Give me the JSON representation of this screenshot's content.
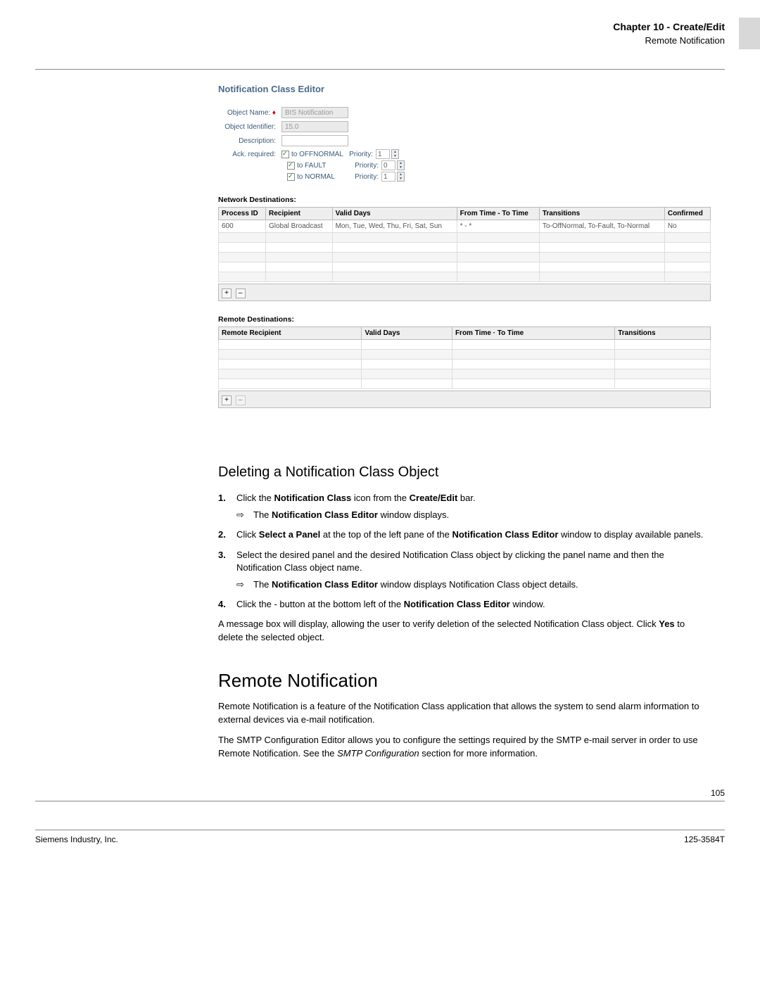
{
  "header": {
    "chapter": "Chapter 10 - Create/Edit",
    "section": "Remote Notification"
  },
  "editor": {
    "title": "Notification Class Editor",
    "labels": {
      "object_name": "Object Name:",
      "object_identifier": "Object Identifier:",
      "description": "Description:",
      "ack_required": "Ack. required:",
      "priority": "Priority:"
    },
    "values": {
      "object_name": "BIS Notification",
      "object_identifier": "15.0",
      "description": ""
    },
    "ack": {
      "offnormal": {
        "label": "to OFFNORMAL",
        "priority": "1"
      },
      "fault": {
        "label": "to FAULT",
        "priority": "0"
      },
      "normal": {
        "label": "to NORMAL",
        "priority": "1"
      }
    },
    "network": {
      "heading": "Network Destinations:",
      "cols": {
        "process_id": "Process ID",
        "recipient": "Recipient",
        "valid_days": "Valid Days",
        "from_to": "From Time - To Time",
        "transitions": "Transitions",
        "confirmed": "Confirmed"
      },
      "row1": {
        "process_id": "600",
        "recipient": "Global Broadcast",
        "valid_days": "Mon, Tue, Wed, Thu, Fri, Sat, Sun",
        "from_to": "*  -  *",
        "transitions": "To-OffNormal, To-Fault, To-Normal",
        "confirmed": "No"
      }
    },
    "remote": {
      "heading": "Remote Destinations:",
      "cols": {
        "remote_recipient": "Remote Recipient",
        "valid_days": "Valid Days",
        "from_to": "From Time · To Time",
        "transitions": "Transitions"
      }
    },
    "buttons": {
      "plus": "+",
      "minus": "–"
    }
  },
  "doc": {
    "deleting_h": "Deleting a Notification Class Object",
    "step1_pre": "Click the ",
    "step1_b1": "Notification Class",
    "step1_mid": " icon from the ",
    "step1_b2": "Create/Edit",
    "step1_post": " bar.",
    "step1_sub_pre": "The ",
    "step1_sub_b": "Notification Class Editor",
    "step1_sub_post": " window displays.",
    "step2_pre": "Click ",
    "step2_b1": "Select a Panel",
    "step2_mid": " at the top of the left pane of the ",
    "step2_b2": "Notification Class Editor",
    "step2_post": " window to display available panels.",
    "step3": "Select the desired panel and the desired Notification Class object by clicking the panel name and then the Notification Class object name.",
    "step3_sub_pre": "The ",
    "step3_sub_b": "Notification Class Editor",
    "step3_sub_post": " window displays Notification Class object details.",
    "step4_pre": "Click the - button at the bottom left of the ",
    "step4_b": "Notification Class Editor",
    "step4_post": " window.",
    "msg_pre": "A message box will display, allowing the user to verify deletion of the selected Notification Class object. Click ",
    "msg_b": "Yes",
    "msg_post": " to delete the selected object.",
    "rn_h": "Remote Notification",
    "rn_p1": "Remote Notification is a feature of the Notification Class application that allows the system to send alarm information to external devices via e-mail notification.",
    "rn_p2_pre": "The SMTP Configuration Editor allows you to configure the settings required by the SMTP e-mail server in order to use Remote Notification. See the ",
    "rn_p2_i": "SMTP Configuration",
    "rn_p2_post": " section for more information."
  },
  "footer": {
    "page": "105",
    "left": "Siemens Industry, Inc.",
    "right": "125-3584T"
  }
}
